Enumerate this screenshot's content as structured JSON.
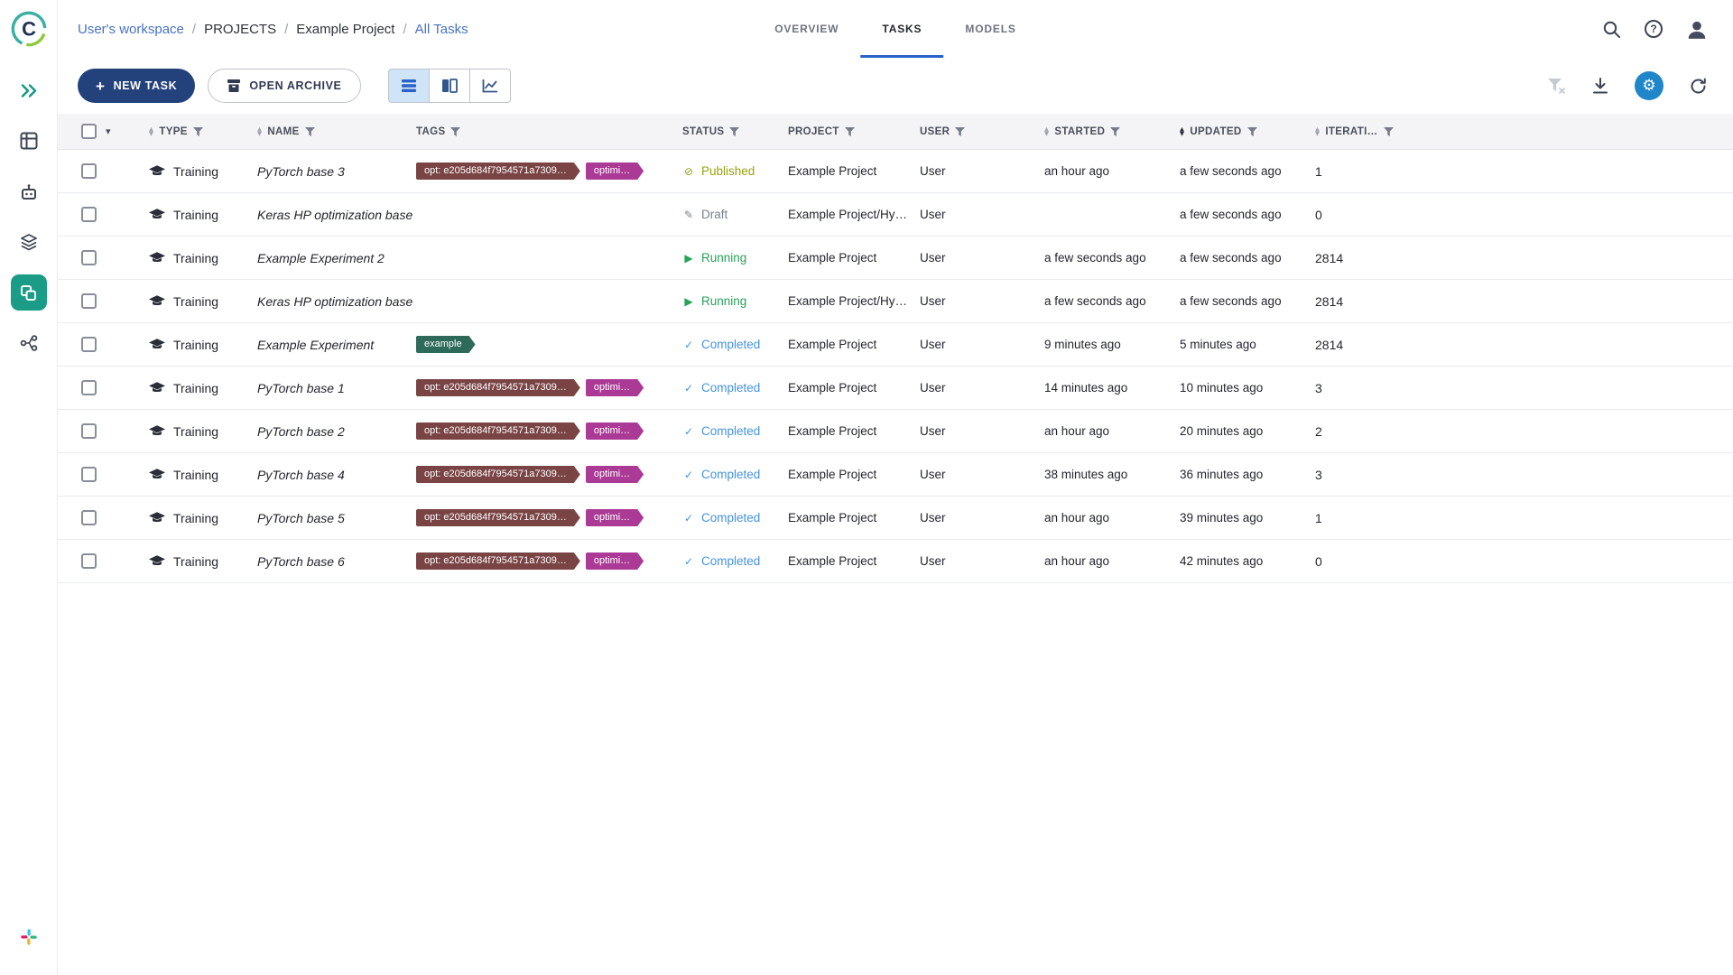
{
  "breadcrumb": {
    "separator": "/",
    "items": [
      {
        "label": "User's workspace"
      },
      {
        "label": "PROJECTS"
      },
      {
        "label": "Example Project"
      },
      {
        "label": "All Tasks"
      }
    ]
  },
  "tabs": [
    {
      "label": "OVERVIEW",
      "active": false
    },
    {
      "label": "TASKS",
      "active": true
    },
    {
      "label": "MODELS",
      "active": false
    }
  ],
  "toolbar": {
    "new_task_label": "NEW TASK",
    "open_archive_label": "OPEN ARCHIVE"
  },
  "icons": {
    "plus": "+",
    "caret_down": "▾",
    "sort_up": "▲",
    "sort_down": "▼",
    "gear": "⚙",
    "refresh": "⟳",
    "help": "?"
  },
  "colors": {
    "accent_blue": "#2a62c9",
    "button_navy": "#23427c",
    "sidebar_active_teal": "#1a9c86",
    "status_published": "#97a30d",
    "status_draft": "#7b808e",
    "status_running": "#27a358",
    "status_completed": "#4493dd",
    "tag_opt": "#7a4444",
    "tag_optimization": "#ab3a96",
    "tag_example": "#2d6a5a"
  },
  "table": {
    "headers": {
      "type": "TYPE",
      "name": "NAME",
      "tags": "TAGS",
      "status": "STATUS",
      "project": "PROJECT",
      "user": "USER",
      "started": "STARTED",
      "updated": "UPDATED",
      "iterations": "ITERATI…"
    },
    "rows": [
      {
        "type": "Training",
        "name": "PyTorch base 3",
        "tags": [
          {
            "label": "opt: e205d684f7954571a7309…",
            "color": "#7a4444"
          },
          {
            "label": "optimi…",
            "color": "#ab3a96"
          }
        ],
        "status": {
          "label": "Published",
          "icon": "⊘",
          "color": "#97a30d"
        },
        "project": "Example Project",
        "user": "User",
        "started": "an hour ago",
        "updated": "a few seconds ago",
        "iterations": "1"
      },
      {
        "type": "Training",
        "name": "Keras HP optimization base",
        "tags": [],
        "status": {
          "label": "Draft",
          "icon": "✎",
          "color": "#7b808e"
        },
        "project": "Example Project/Hy…",
        "user": "User",
        "started": "",
        "updated": "a few seconds ago",
        "iterations": "0"
      },
      {
        "type": "Training",
        "name": "Example Experiment 2",
        "tags": [],
        "status": {
          "label": "Running",
          "icon": "▶",
          "color": "#27a358"
        },
        "project": "Example Project",
        "user": "User",
        "started": "a few seconds ago",
        "updated": "a few seconds ago",
        "iterations": "2814"
      },
      {
        "type": "Training",
        "name": "Keras HP optimization base",
        "tags": [],
        "status": {
          "label": "Running",
          "icon": "▶",
          "color": "#27a358"
        },
        "project": "Example Project/Hy…",
        "user": "User",
        "started": "a few seconds ago",
        "updated": "a few seconds ago",
        "iterations": "2814"
      },
      {
        "type": "Training",
        "name": "Example Experiment",
        "tags": [
          {
            "label": "example",
            "color": "#2d6a5a"
          }
        ],
        "status": {
          "label": "Completed",
          "icon": "✓",
          "color": "#4493dd"
        },
        "project": "Example Project",
        "user": "User",
        "started": "9 minutes ago",
        "updated": "5 minutes ago",
        "iterations": "2814"
      },
      {
        "type": "Training",
        "name": "PyTorch base 1",
        "tags": [
          {
            "label": "opt: e205d684f7954571a7309…",
            "color": "#7a4444"
          },
          {
            "label": "optimi…",
            "color": "#ab3a96"
          }
        ],
        "status": {
          "label": "Completed",
          "icon": "✓",
          "color": "#4493dd"
        },
        "project": "Example Project",
        "user": "User",
        "started": "14 minutes ago",
        "updated": "10 minutes ago",
        "iterations": "3"
      },
      {
        "type": "Training",
        "name": "PyTorch base 2",
        "tags": [
          {
            "label": "opt: e205d684f7954571a7309…",
            "color": "#7a4444"
          },
          {
            "label": "optimi…",
            "color": "#ab3a96"
          }
        ],
        "status": {
          "label": "Completed",
          "icon": "✓",
          "color": "#4493dd"
        },
        "project": "Example Project",
        "user": "User",
        "started": "an hour ago",
        "updated": "20 minutes ago",
        "iterations": "2"
      },
      {
        "type": "Training",
        "name": "PyTorch base 4",
        "tags": [
          {
            "label": "opt: e205d684f7954571a7309…",
            "color": "#7a4444"
          },
          {
            "label": "optimi…",
            "color": "#ab3a96"
          }
        ],
        "status": {
          "label": "Completed",
          "icon": "✓",
          "color": "#4493dd"
        },
        "project": "Example Project",
        "user": "User",
        "started": "38 minutes ago",
        "updated": "36 minutes ago",
        "iterations": "3"
      },
      {
        "type": "Training",
        "name": "PyTorch base 5",
        "tags": [
          {
            "label": "opt: e205d684f7954571a7309…",
            "color": "#7a4444"
          },
          {
            "label": "optimi…",
            "color": "#ab3a96"
          }
        ],
        "status": {
          "label": "Completed",
          "icon": "✓",
          "color": "#4493dd"
        },
        "project": "Example Project",
        "user": "User",
        "started": "an hour ago",
        "updated": "39 minutes ago",
        "iterations": "1"
      },
      {
        "type": "Training",
        "name": "PyTorch base 6",
        "tags": [
          {
            "label": "opt: e205d684f7954571a7309…",
            "color": "#7a4444"
          },
          {
            "label": "optimi…",
            "color": "#ab3a96"
          }
        ],
        "status": {
          "label": "Completed",
          "icon": "✓",
          "color": "#4493dd"
        },
        "project": "Example Project",
        "user": "User",
        "started": "an hour ago",
        "updated": "42 minutes ago",
        "iterations": "0"
      }
    ]
  }
}
